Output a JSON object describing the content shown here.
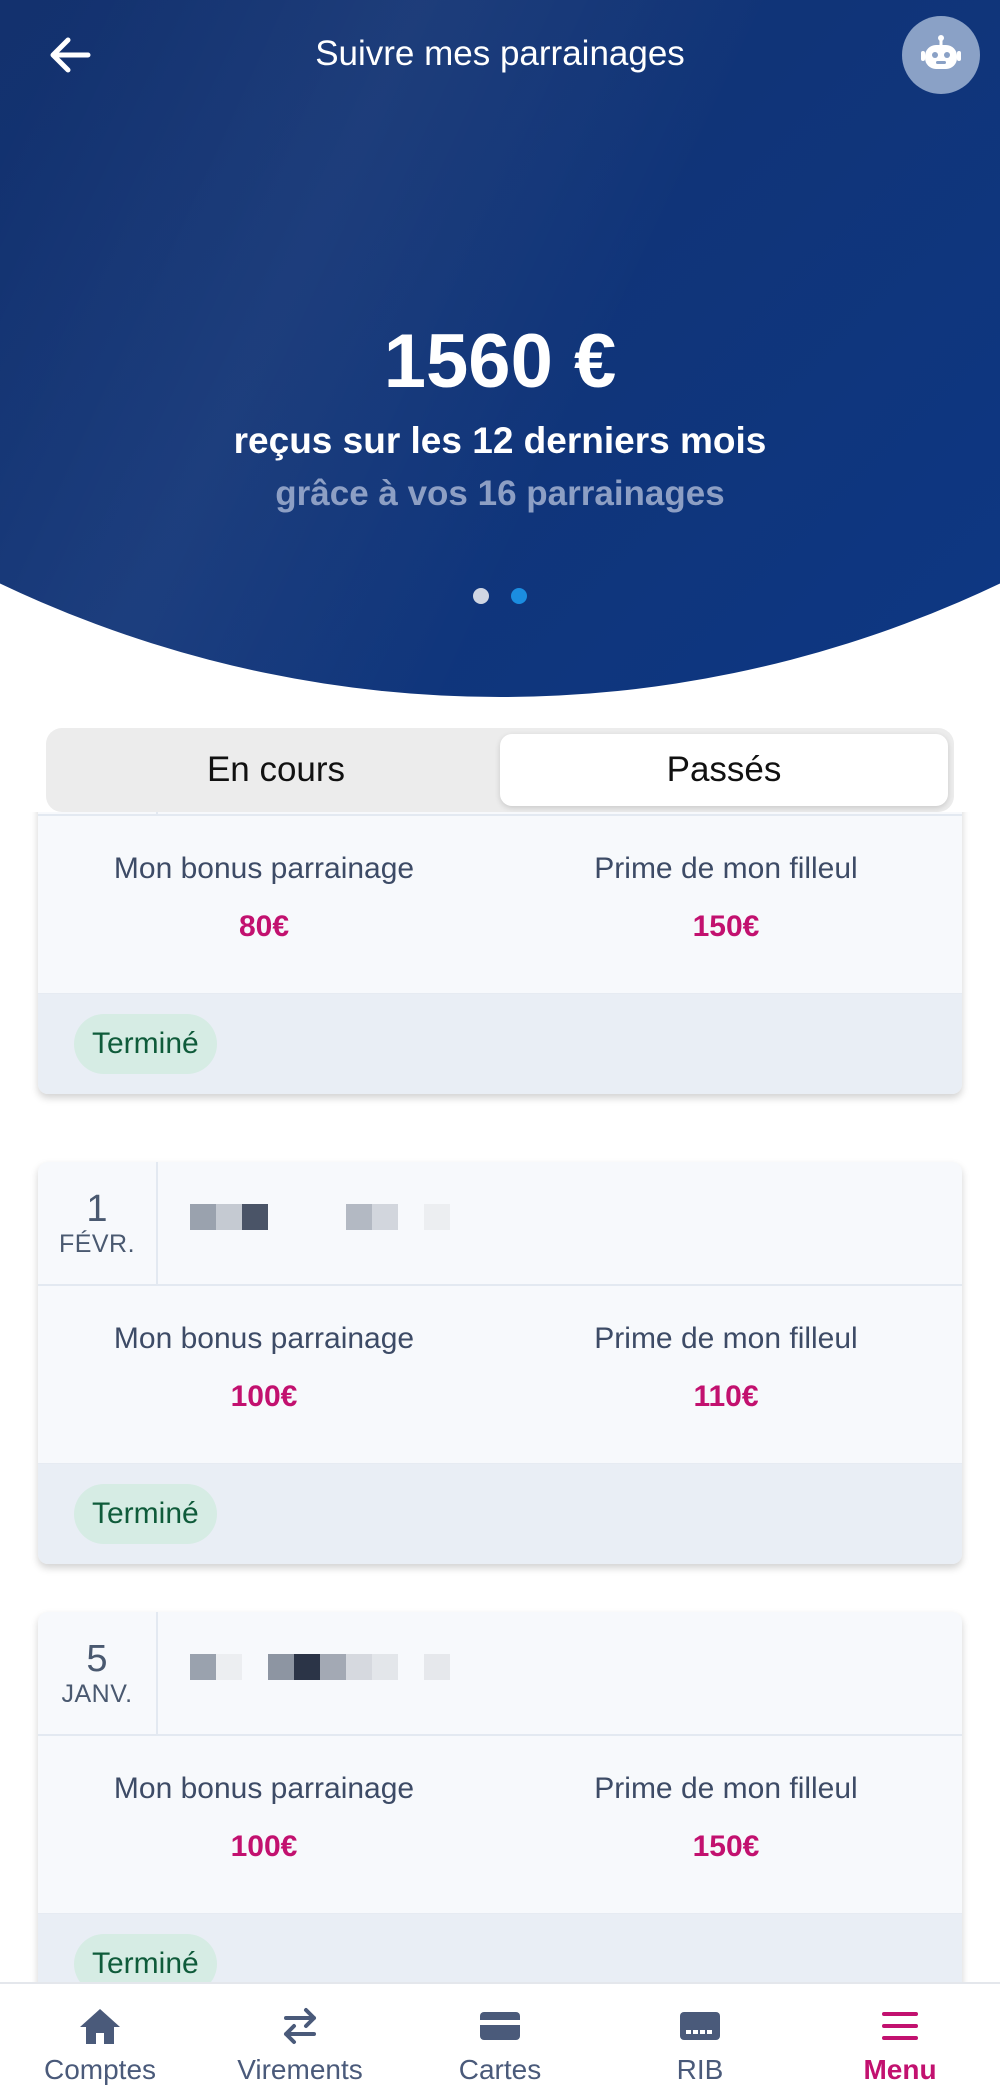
{
  "header": {
    "title": "Suivre mes parrainages"
  },
  "hero": {
    "amount": "1560 €",
    "line1": "reçus sur les 12 derniers mois",
    "line2": "grâce à vos 16 parrainages",
    "carousel_total": 2,
    "carousel_active_index": 1
  },
  "tabs": [
    {
      "label": "En cours",
      "selected": false
    },
    {
      "label": "Passés",
      "selected": true
    }
  ],
  "cards": [
    {
      "day": "",
      "month": "",
      "bonus_label": "Mon bonus parrainage",
      "bonus_value": "80€",
      "prime_label": "Prime de mon filleul",
      "prime_value": "150€",
      "status": "Terminé"
    },
    {
      "day": "1",
      "month": "FÉVR.",
      "bonus_label": "Mon bonus parrainage",
      "bonus_value": "100€",
      "prime_label": "Prime de mon filleul",
      "prime_value": "110€",
      "status": "Terminé"
    },
    {
      "day": "5",
      "month": "JANV.",
      "bonus_label": "Mon bonus parrainage",
      "bonus_value": "100€",
      "prime_label": "Prime de mon filleul",
      "prime_value": "150€",
      "status": "Terminé"
    }
  ],
  "bottom_nav": [
    {
      "label": "Comptes",
      "icon": "home-icon",
      "active": false
    },
    {
      "label": "Virements",
      "icon": "transfer-icon",
      "active": false
    },
    {
      "label": "Cartes",
      "icon": "card-icon",
      "active": false
    },
    {
      "label": "RIB",
      "icon": "rib-icon",
      "active": false
    },
    {
      "label": "Menu",
      "icon": "menu-icon",
      "active": true
    }
  ],
  "colors": {
    "brand_dark": "#14306a",
    "accent_pink": "#c2116f",
    "dot_active": "#1b8de0",
    "badge_bg": "#d6ece4",
    "badge_text": "#0f5b3a"
  }
}
